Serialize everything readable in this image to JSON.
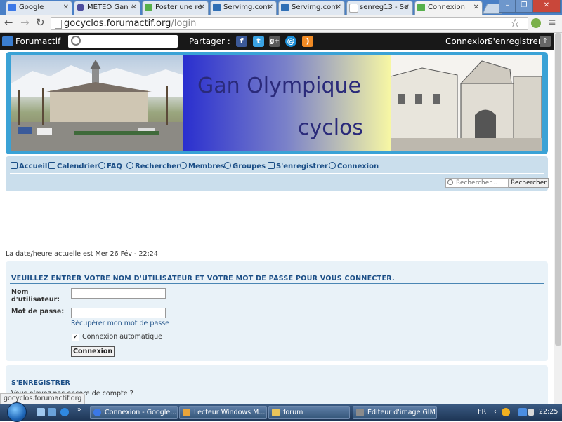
{
  "browser": {
    "tabs": [
      {
        "label": "Google",
        "fav": "#3b78e7"
      },
      {
        "label": "METEO Gan -",
        "fav": "#4c4c9e"
      },
      {
        "label": "Poster une ré",
        "fav": "#56b04b"
      },
      {
        "label": "Servimg.com",
        "fav": "#2f6fb5"
      },
      {
        "label": "Servimg.com",
        "fav": "#2f6fb5"
      },
      {
        "label": "senreg13 - Se",
        "fav": "#cccccc"
      },
      {
        "label": "Connexion",
        "fav": "#56b04b",
        "active": true
      }
    ],
    "url_domain": "gocyclos.forumactif.org",
    "url_path": "/login"
  },
  "forumactif_bar": {
    "brand": "Forumactif",
    "share_label": "Partager :",
    "social_icons": [
      "facebook-icon",
      "twitter-icon",
      "google-plus-icon",
      "email-icon",
      "rss-icon"
    ],
    "login": "Connexion",
    "register": "S'enregistrer"
  },
  "banner": {
    "title_line1": "Gan Olympique",
    "title_line2": "cyclos"
  },
  "nav": {
    "items": [
      "Accueil",
      "Calendrier",
      "FAQ",
      "Rechercher",
      "Membres",
      "Groupes",
      "S'enregistrer",
      "Connexion"
    ],
    "search_placeholder": "Rechercher...",
    "search_button": "Rechercher"
  },
  "datetime": "La date/heure actuelle est Mer 26 Fév - 22:24",
  "login_form": {
    "heading": "VEUILLEZ ENTRER VOTRE NOM D'UTILISATEUR ET VOTRE MOT DE PASSE POUR VOUS CONNECTER.",
    "username_label_1": "Nom",
    "username_label_2": "d'utilisateur:",
    "password_label": "Mot de passe:",
    "recover_link": "Récupérer mon mot de passe",
    "auto_login_label": "Connexion automatique",
    "submit": "Connexion"
  },
  "register_section": {
    "heading": "S'ENREGISTRER",
    "text": "Vous n'avez pas encore de compte ?"
  },
  "statusbar": "gocyclos.forumactif.org",
  "taskbar": {
    "buttons": [
      {
        "label": "Connexion - Google...",
        "icon": "#3b78e7"
      },
      {
        "label": "Lecteur Windows M...",
        "icon": "#e8a43a"
      },
      {
        "label": "forum",
        "icon": "#e8c45a"
      },
      {
        "label": "Éditeur d'image GIMP",
        "icon": "#8b8b8b"
      }
    ],
    "lang": "FR",
    "time": "22:25"
  }
}
